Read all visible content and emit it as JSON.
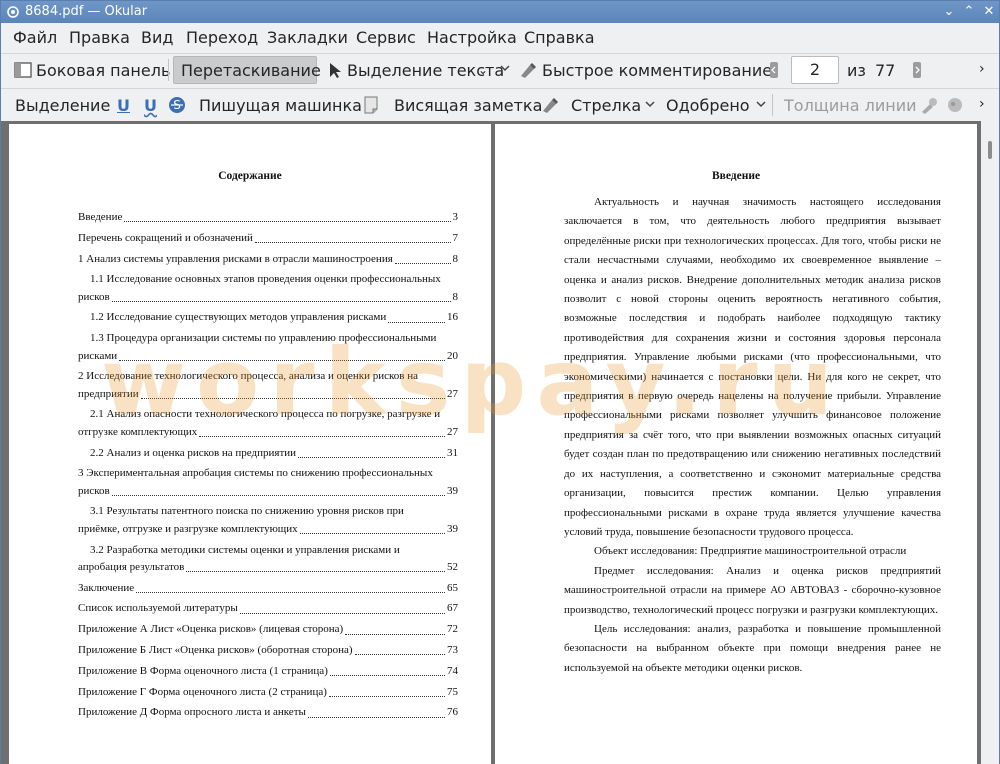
{
  "window": {
    "title": "8684.pdf  — Okular"
  },
  "menu": [
    "Файл",
    "Правка",
    "Вид",
    "Переход",
    "Закладки",
    "Сервис",
    "Настройка",
    "Справка"
  ],
  "toolbar1": {
    "sidebar": "Боковая панель",
    "drag": "Перетаскивание",
    "text_select": "Выделение текста",
    "quick_comment": "Быстрое комментирование",
    "page_current": "2",
    "page_of": "из",
    "page_total": "77"
  },
  "toolbar2": {
    "highlight": "Выделение",
    "underline1": "U",
    "underline2": "U",
    "typewriter": "Пишущая машинка",
    "note": "Висящая заметка",
    "arrow": "Стрелка",
    "stamp": "Одобрено",
    "line_width": "Толщина линии"
  },
  "page_left": {
    "title": "Содержание",
    "toc": [
      {
        "text": "Введение",
        "page": "3"
      },
      {
        "text": "Перечень сокращений и обозначений",
        "page": "7"
      },
      {
        "text": "1 Анализ системы управления рисками в отрасли машиностроения",
        "page": "8"
      },
      {
        "text": "1.1 Исследование основных этапов проведения оценки профессиональных",
        "text2": "рисков",
        "page": "8"
      },
      {
        "text": "1.2 Исследование существующих методов управления рисками",
        "page": "16",
        "indent": true
      },
      {
        "text": "1.3 Процедура организации системы по управлению профессиональными",
        "text2": "рисками",
        "page": "20"
      },
      {
        "text": "2 Исследование технологического процесса, анализа и оценки рисков на",
        "text2": "предприятии",
        "page": "27",
        "noindent": true
      },
      {
        "text": "2.1 Анализ опасности технологического процесса по погрузке, разгрузке и",
        "text2": "отгрузке комплектующих",
        "page": "27"
      },
      {
        "text": "2.2 Анализ и оценка рисков на предприятии",
        "page": "31",
        "indent": true
      },
      {
        "text": "3 Экспериментальная апробация системы по снижению профессиональных",
        "text2": "рисков",
        "page": "39",
        "noindent": true
      },
      {
        "text": "3.1 Результаты патентного поиска по снижению уровня рисков при",
        "text2": "приёмке, отгрузке и разгрузке комплектующих",
        "page": "39"
      },
      {
        "text": "3.2 Разработка методики системы оценки и управления рисками и",
        "text2": "апробация результатов",
        "page": "52"
      },
      {
        "text": "Заключение",
        "page": "65"
      },
      {
        "text": "Список используемой литературы",
        "page": "67"
      },
      {
        "text": "Приложение А Лист «Оценка рисков» (лицевая сторона)",
        "page": "72"
      },
      {
        "text": "Приложение Б Лист «Оценка рисков» (оборотная сторона)",
        "page": "73"
      },
      {
        "text": "Приложение В Форма оценочного листа (1 страница)",
        "page": "74"
      },
      {
        "text": "Приложение Г Форма оценочного листа (2 страница)",
        "page": "75"
      },
      {
        "text": "Приложение Д Форма опросного листа и анкеты",
        "page": "76"
      }
    ]
  },
  "page_right": {
    "title": "Введение",
    "paragraphs": [
      "Актуальность и научная значимость настоящего исследования заключается в том, что деятельность любого предприятия вызывает определённые риски при технологических процессах. Для того, чтобы риски не стали несчастными случаями, необходимо их своевременное выявление – оценка и анализ рисков. Внедрение дополнительных методик анализа рисков позволит с новой стороны оценить вероятность негативного события, возможные последствия и подобрать наиболее подходящую тактику противодействия для сохранения жизни и состояния здоровья персонала предприятия. Управление любыми рисками (что профессиональными, что экономическими) начинается с постановки цели. Ни для кого не секрет, что предприятия в первую очередь нацелены на получение прибыли. Управление профессиональными рисками позволяет улучшить финансовое положение предприятия за счёт того, что при выявлении возможных опасных ситуаций будет создан план по предотвращению или снижению негативных последствий до их наступления, а соответственно и сэкономит материальные средства организации, повысится престиж компании. Целью управления профессиональными рисками в охране труда является улучшение качества условий труда, повышение безопасности трудового процесса.",
      "Объект исследования: Предприятие машиностроительной отрасли",
      "Предмет исследования: Анализ и оценка рисков предприятий машиностроительной отрасли на примере АО АВТОВАЗ - сборочно-кузовное производство, технологический процесс погрузки и разгрузки комплектующих.",
      "Цель исследования: анализ, разработка и повышение промышленной безопасности на выбранном объекте при помощи внедрения ранее не используемой на объекте методики оценки рисков."
    ]
  },
  "watermark": "workspay.ru"
}
